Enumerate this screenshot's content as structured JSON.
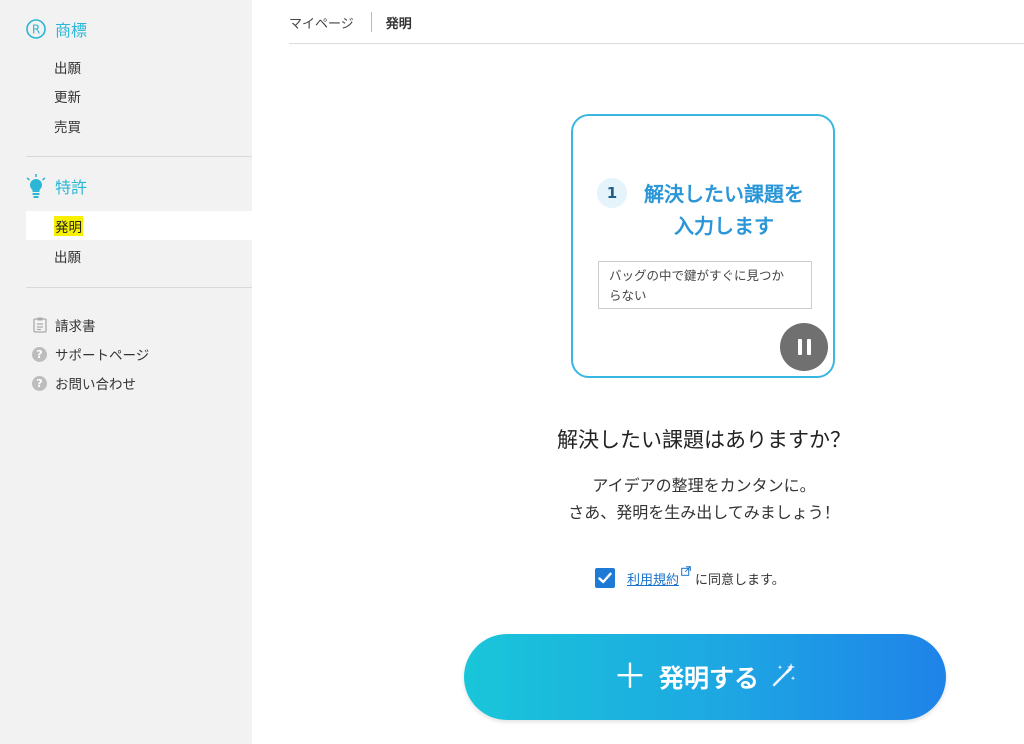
{
  "sidebar": {
    "trademark": {
      "title": "商標",
      "icon": "registered-icon",
      "items": [
        "出願",
        "更新",
        "売買"
      ]
    },
    "patent": {
      "title": "特許",
      "icon": "lightbulb-icon",
      "items": [
        "発明",
        "出願"
      ],
      "active": "発明"
    },
    "utilities": [
      {
        "label": "請求書",
        "icon": "clipboard-icon"
      },
      {
        "label": "サポートページ",
        "icon": "question-icon"
      },
      {
        "label": "お問い合わせ",
        "icon": "question-icon"
      }
    ]
  },
  "breadcrumb": {
    "home": "マイページ",
    "current": "発明"
  },
  "card": {
    "step_number": "1",
    "step_text_line1": "解決したい課題を",
    "step_text_line2": "入力します",
    "example_line1": "バッグの中で鍵がすぐに見つか",
    "example_line2": "らない",
    "pause_icon": "pause-icon"
  },
  "main": {
    "headline": "解決したい課題はありますか？",
    "sub_line1": "アイデアの整理をカンタンに。",
    "sub_line2": "さあ、発明を生み出してみましょう！"
  },
  "consent": {
    "checked": true,
    "link_text": "利用規約",
    "suffix": "に同意します。"
  },
  "cta": {
    "label": "発明する",
    "icon": "magic-wand-icon"
  },
  "colors": {
    "accent": "#2bb6d6",
    "card_border": "#3ab7e0",
    "link": "#1a73c9",
    "highlight": "#f7f000",
    "cta_start": "#19c6d9",
    "cta_end": "#1f83e8"
  }
}
